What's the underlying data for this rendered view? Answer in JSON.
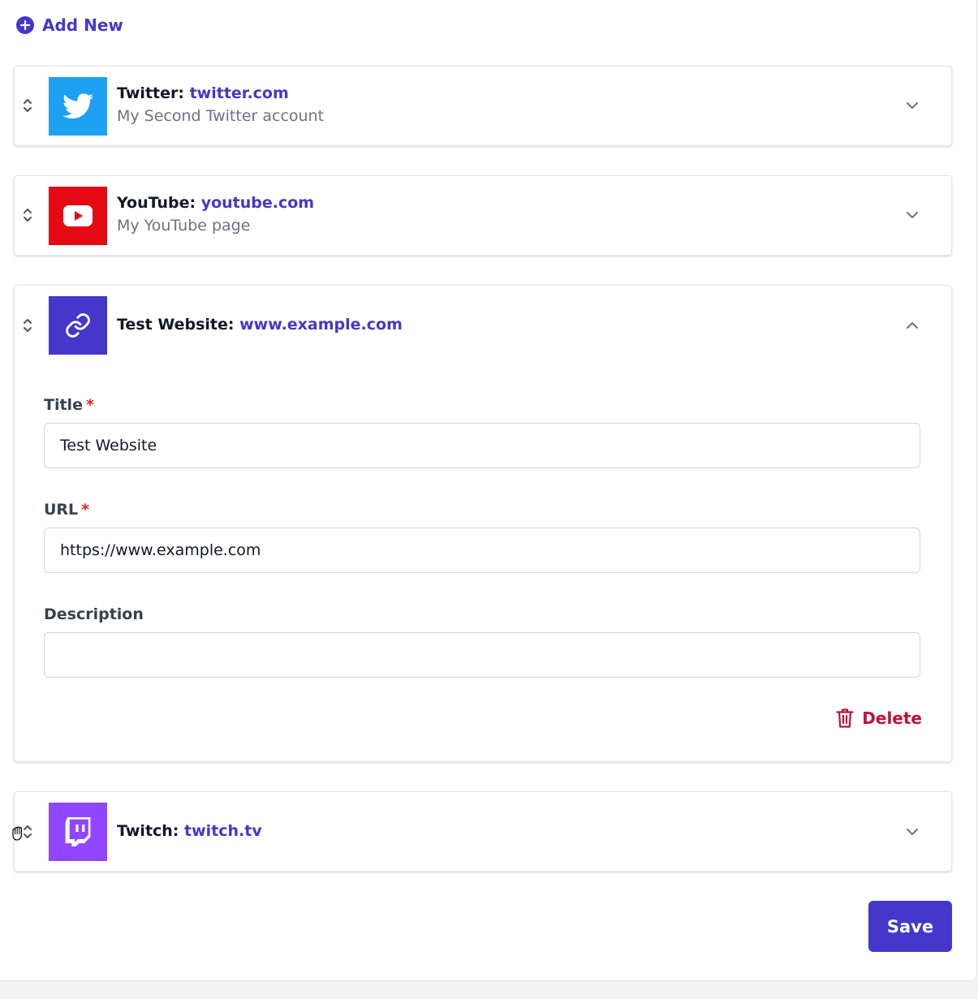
{
  "add_new": {
    "label": "Add New"
  },
  "items": [
    {
      "platform": "Twitter:",
      "domain": "twitter.com",
      "description": "My Second Twitter account",
      "logo_color": "#1da1f2",
      "icon": "twitter-icon",
      "expanded": false
    },
    {
      "platform": "YouTube:",
      "domain": "youtube.com",
      "description": "My YouTube page",
      "logo_color": "#e50914",
      "icon": "youtube-icon",
      "expanded": false
    },
    {
      "platform": "Test Website:",
      "domain": "www.example.com",
      "description": "",
      "logo_color": "#4338ca",
      "icon": "link-icon",
      "expanded": true
    },
    {
      "platform": "Twitch:",
      "domain": "twitch.tv",
      "description": "",
      "logo_color": "#9146ff",
      "icon": "twitch-icon",
      "expanded": false
    }
  ],
  "form": {
    "title_label": "Title",
    "title_value": "Test Website",
    "url_label": "URL",
    "url_value": "https://www.example.com",
    "description_label": "Description",
    "description_value": "",
    "required_mark": "*",
    "delete_label": "Delete"
  },
  "save_label": "Save",
  "colors": {
    "accent": "#4338ca",
    "danger": "#be123c",
    "required": "#dc2626"
  }
}
